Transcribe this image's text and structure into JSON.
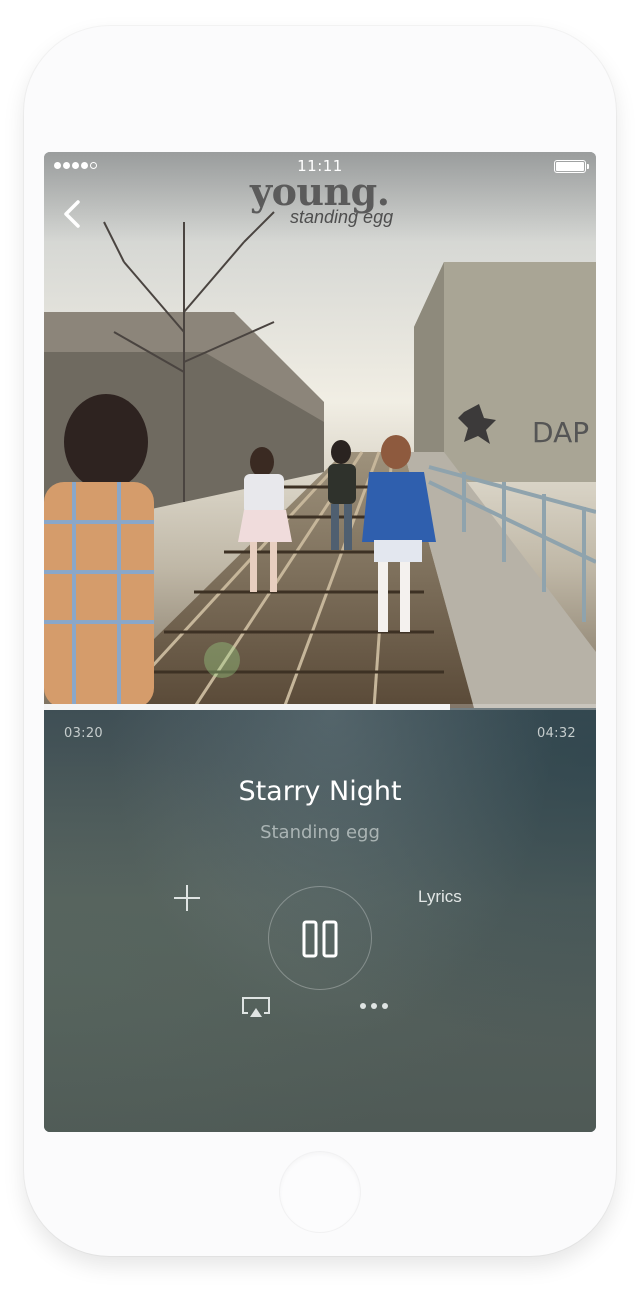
{
  "status_bar": {
    "time": "11:11",
    "signal_bars_filled": 4,
    "signal_bars_total": 5
  },
  "album": {
    "title": "young.",
    "subtitle": "standing egg"
  },
  "player": {
    "elapsed": "03:20",
    "total": "04:32",
    "progress_fraction": 0.735,
    "song_title": "Starry Night",
    "artist": "Standing egg",
    "lyrics_label": "Lyrics",
    "state": "playing"
  },
  "icons": {
    "back": "chevron-left-icon",
    "add": "plus-icon",
    "pause": "pause-icon",
    "airplay": "airplay-icon",
    "more": "more-dots-icon"
  },
  "colors": {
    "player_bg": "#46545a",
    "text_primary": "#ffffff",
    "text_secondary": "#aab4b4"
  }
}
